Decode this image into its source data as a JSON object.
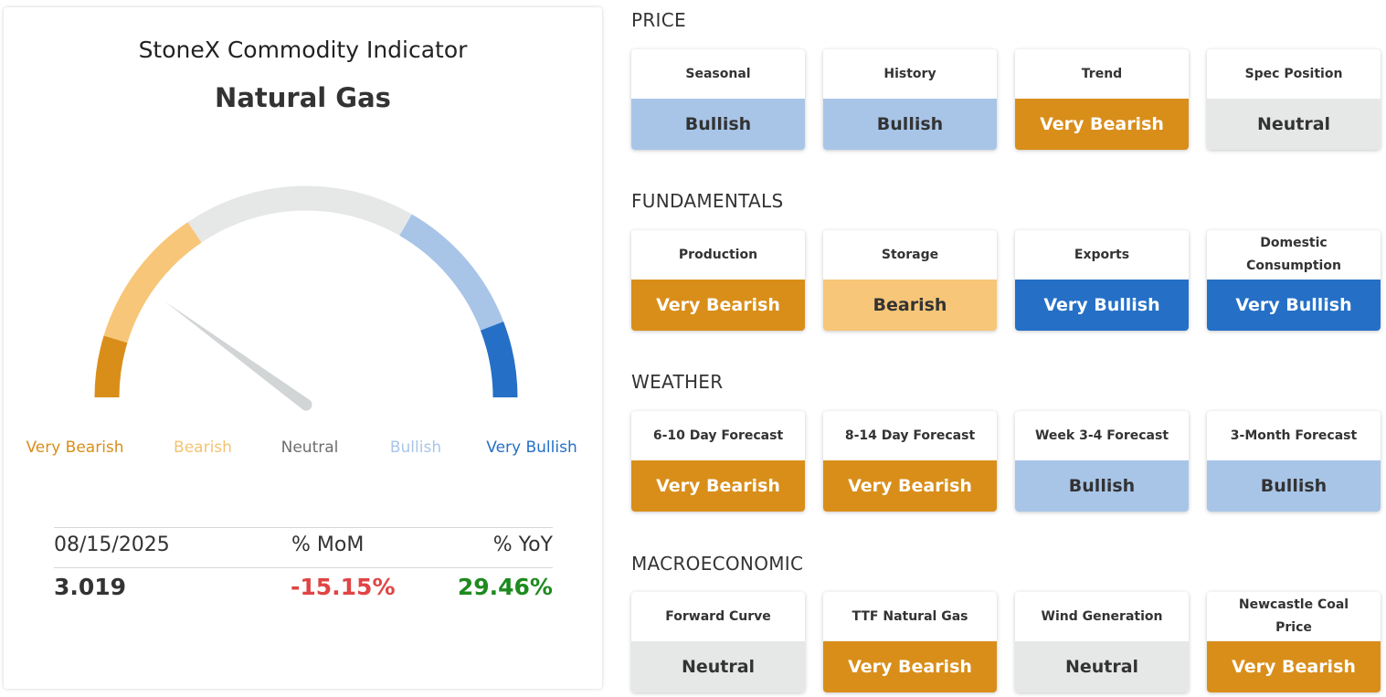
{
  "indicator": {
    "title": "StoneX Commodity Indicator",
    "commodity": "Natural Gas",
    "gauge_position": 0.19,
    "scale": [
      {
        "label": "Very Bearish",
        "color": "#d98e1a"
      },
      {
        "label": "Bearish",
        "color": "#f7c678"
      },
      {
        "label": "Neutral",
        "color": "#e6e8e7"
      },
      {
        "label": "Bullish",
        "color": "#a8c5e8"
      },
      {
        "label": "Very Bullish",
        "color": "#2570c6"
      }
    ],
    "stats": {
      "date": "08/15/2025",
      "mom_label": "% MoM",
      "yoy_label": "% YoY",
      "price": "3.019",
      "mom": "-15.15%",
      "yoy": "29.46%",
      "mom_color": "#e04444",
      "yoy_color": "#1e8a1e"
    }
  },
  "sections": [
    {
      "title": "PRICE",
      "tiles": [
        {
          "label": "Seasonal",
          "value": "Bullish"
        },
        {
          "label": "History",
          "value": "Bullish"
        },
        {
          "label": "Trend",
          "value": "Very Bearish"
        },
        {
          "label": "Spec Position",
          "value": "Neutral"
        }
      ]
    },
    {
      "title": "FUNDAMENTALS",
      "tiles": [
        {
          "label": "Production",
          "value": "Very Bearish"
        },
        {
          "label": "Storage",
          "value": "Bearish"
        },
        {
          "label": "Exports",
          "value": "Very Bullish"
        },
        {
          "label": "Domestic Consumption",
          "value": "Very Bullish"
        }
      ]
    },
    {
      "title": "WEATHER",
      "tiles": [
        {
          "label": "6-10 Day Forecast",
          "value": "Very Bearish"
        },
        {
          "label": "8-14 Day Forecast",
          "value": "Very Bearish"
        },
        {
          "label": "Week 3-4 Forecast",
          "value": "Bullish"
        },
        {
          "label": "3-Month Forecast",
          "value": "Bullish"
        }
      ]
    },
    {
      "title": "MACROECONOMIC",
      "tiles": [
        {
          "label": "Forward Curve",
          "value": "Neutral"
        },
        {
          "label": "TTF Natural Gas",
          "value": "Very Bearish"
        },
        {
          "label": "Wind Generation",
          "value": "Neutral"
        },
        {
          "label": "Newcastle Coal Price",
          "value": "Very Bearish"
        }
      ]
    }
  ]
}
